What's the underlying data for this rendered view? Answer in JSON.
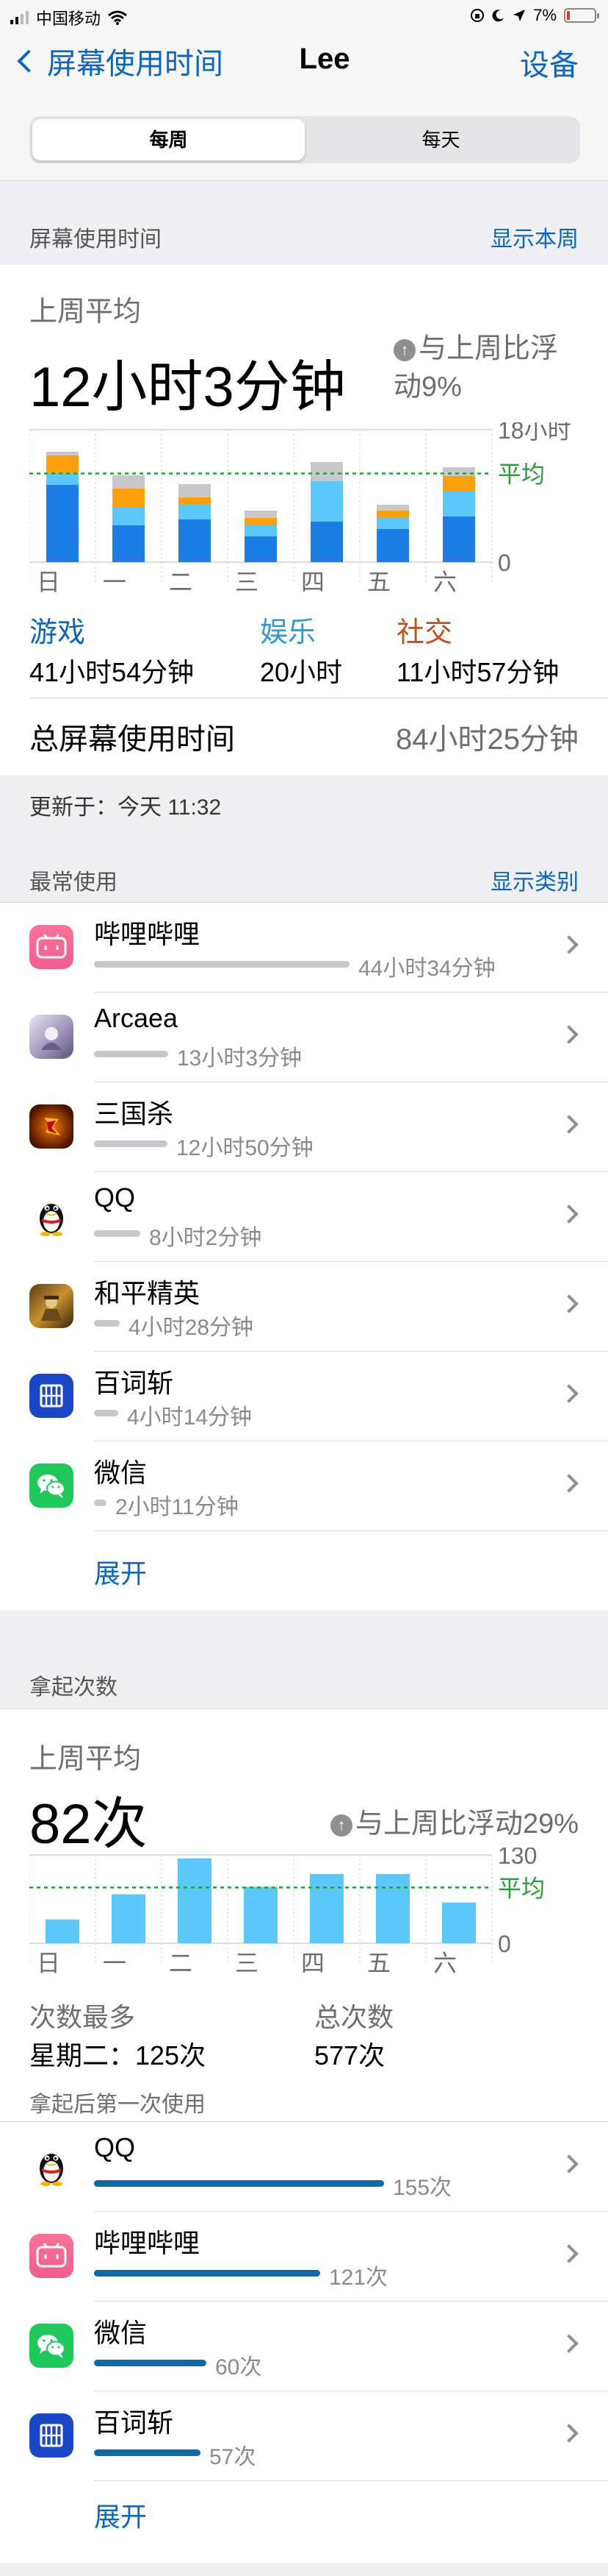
{
  "status": {
    "carrier": "中国移动",
    "battery": "7%"
  },
  "nav": {
    "back": "屏幕使用时间",
    "title": "Lee",
    "right": "设备"
  },
  "segment": {
    "weekly": "每周",
    "daily": "每天"
  },
  "screen_time": {
    "header": "屏幕使用时间",
    "header_link": "显示本周",
    "avg_label": "上周平均",
    "avg_value": "12小时3分钟",
    "change": "与上周比浮动9%",
    "axis_max": "18小时",
    "avg_line_label": "平均",
    "axis_zero": "0",
    "days": [
      "日",
      "一",
      "二",
      "三",
      "四",
      "五",
      "六"
    ],
    "categories": [
      {
        "name": "游戏",
        "value": "41小时54分钟",
        "color": "#0a66c2"
      },
      {
        "name": "娱乐",
        "value": "20小时",
        "color": "#2e9ad0"
      },
      {
        "name": "社交",
        "value": "11小时57分钟",
        "color": "#c0501a"
      }
    ],
    "total_label": "总屏幕使用时间",
    "total_value": "84小时25分钟",
    "updated": "更新于：今天 11:32"
  },
  "chart_data": [
    {
      "type": "bar",
      "stacked": true,
      "categories": [
        "日",
        "一",
        "二",
        "三",
        "四",
        "五",
        "六"
      ],
      "series": [
        {
          "name": "游戏",
          "color": "#1a7ee6",
          "values": [
            10.5,
            5.0,
            5.8,
            3.5,
            5.5,
            4.5,
            6.2
          ]
        },
        {
          "name": "娱乐",
          "color": "#5ac8fa",
          "values": [
            1.5,
            2.5,
            2.0,
            1.5,
            5.5,
            1.5,
            3.5
          ]
        },
        {
          "name": "社交",
          "color": "#ff9f0a",
          "values": [
            2.5,
            2.5,
            1.0,
            1.0,
            0,
            1.0,
            2.0
          ]
        },
        {
          "name": "其他",
          "color": "#c7c7cc",
          "values": [
            0.5,
            1.8,
            1.8,
            1.0,
            2.6,
            0.8,
            1.2
          ]
        }
      ],
      "ylim": [
        0,
        18
      ],
      "average": 12.05,
      "ylabel_top": "18小时"
    },
    {
      "type": "bar",
      "categories": [
        "日",
        "一",
        "二",
        "三",
        "四",
        "五",
        "六"
      ],
      "values": [
        35,
        72,
        125,
        83,
        102,
        102,
        60
      ],
      "ylim": [
        0,
        130
      ],
      "average": 82,
      "color": "#5ac8fa"
    }
  ],
  "most_used": {
    "header": "最常使用",
    "header_link": "显示类别",
    "apps": [
      {
        "name": "哔哩哔哩",
        "value": "44小时34分钟",
        "fraction": 1.0,
        "icon": "bilibili-icon"
      },
      {
        "name": "Arcaea",
        "value": "13小时3分钟",
        "fraction": 0.29,
        "icon": "arcaea-icon"
      },
      {
        "name": "三国杀",
        "value": "12小时50分钟",
        "fraction": 0.288,
        "icon": "sanguosha-icon"
      },
      {
        "name": "QQ",
        "value": "8小时2分钟",
        "fraction": 0.18,
        "icon": "qq-icon"
      },
      {
        "name": "和平精英",
        "value": "4小时28分钟",
        "fraction": 0.1,
        "icon": "heping-icon"
      },
      {
        "name": "百词斩",
        "value": "4小时14分钟",
        "fraction": 0.095,
        "icon": "baicizhan-icon"
      },
      {
        "name": "微信",
        "value": "2小时11分钟",
        "fraction": 0.049,
        "icon": "wechat-icon"
      }
    ],
    "expand": "展开"
  },
  "pickups": {
    "header": "拿起次数",
    "avg_label": "上周平均",
    "avg_value": "82次",
    "change": "与上周比浮动29%",
    "axis_max": "130",
    "avg_line_label": "平均",
    "axis_zero": "0",
    "most_label": "次数最多",
    "most_value": "星期二：125次",
    "total_label": "总次数",
    "total_value": "577次",
    "first_use_label": "拿起后第一次使用",
    "apps": [
      {
        "name": "QQ",
        "value": "155次",
        "fraction": 1.0,
        "icon": "qq-icon"
      },
      {
        "name": "哔哩哔哩",
        "value": "121次",
        "fraction": 0.78,
        "icon": "bilibili-icon"
      },
      {
        "name": "微信",
        "value": "60次",
        "fraction": 0.387,
        "icon": "wechat-icon"
      },
      {
        "name": "百词斩",
        "value": "57次",
        "fraction": 0.368,
        "icon": "baicizhan-icon"
      }
    ],
    "expand": "展开"
  }
}
